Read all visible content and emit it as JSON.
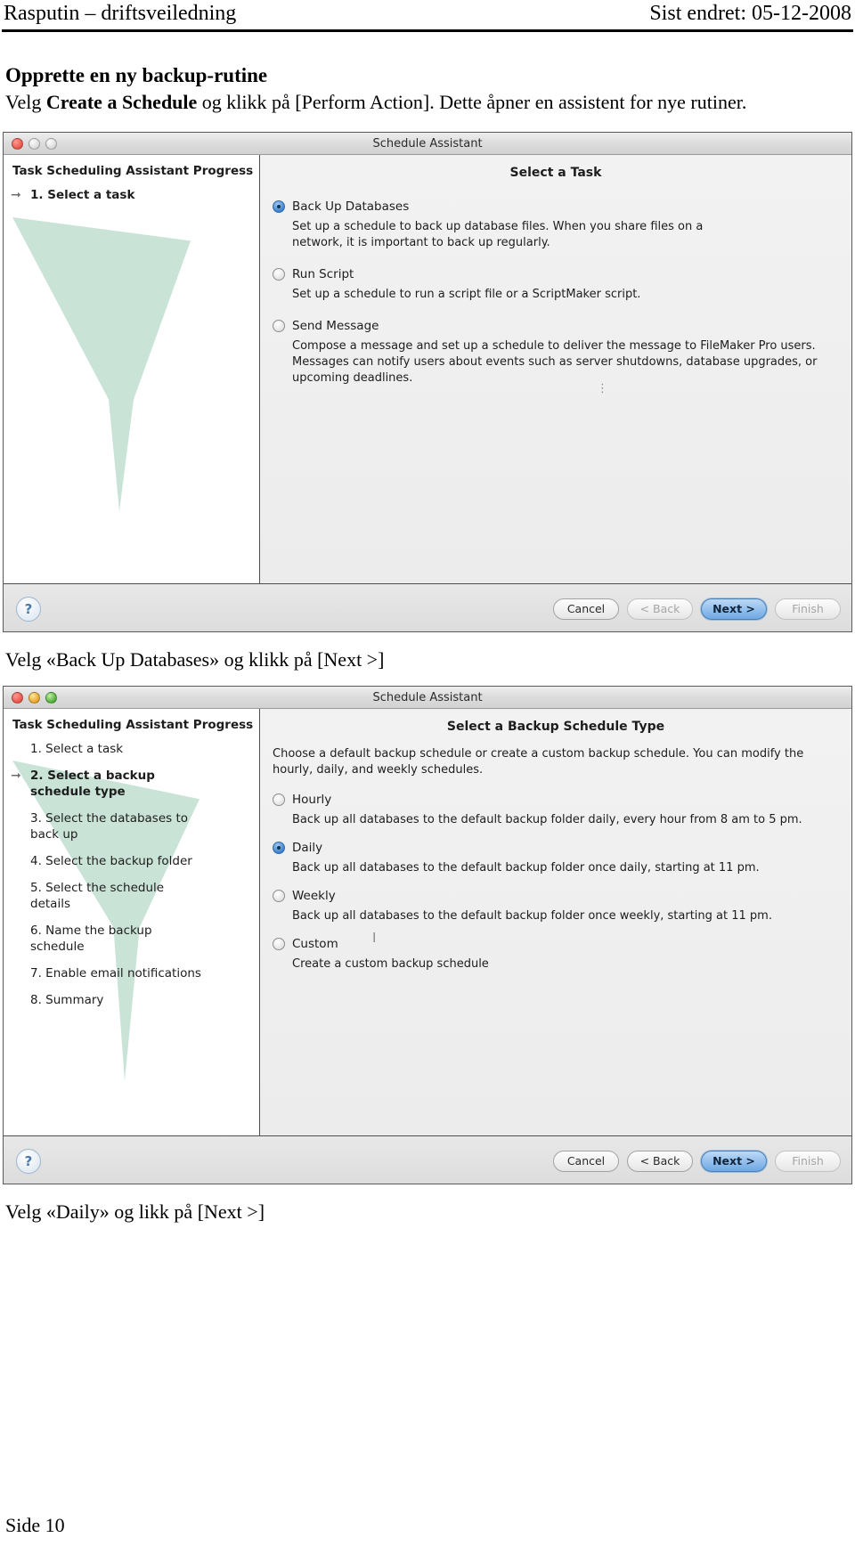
{
  "page": {
    "header_left": "Rasputin – driftsveiledning",
    "header_right": "Sist endret: 05-12-2008",
    "footer": "Side 10",
    "heading": "Opprette en ny backup-rutine",
    "intro_before": "Velg ",
    "intro_bold": "Create a Schedule",
    "intro_after": " og klikk på [Perform Action]. Dette åpner en assistent for nye rutiner.",
    "caption_1": "Velg «Back Up Databases» og klikk på [Next >]",
    "caption_2": "Velg «Daily» og likk på [Next >]"
  },
  "window1": {
    "title": "Schedule Assistant",
    "traffic": {
      "close": "close-button",
      "minimize": "minimize-button",
      "zoom": "zoom-button"
    },
    "sidebar": {
      "heading": "Task Scheduling Assistant Progress",
      "steps": [
        {
          "label": "1. Select a task",
          "current": true
        }
      ]
    },
    "content": {
      "title": "Select a Task",
      "options": [
        {
          "label": "Back Up Databases",
          "selected": true,
          "desc": "Set up a schedule to back up database files. When you share files on a network, it is important to back up regularly."
        },
        {
          "label": "Run Script",
          "selected": false,
          "desc": "Set up a schedule to run a script file or a ScriptMaker script."
        },
        {
          "label": "Send Message",
          "selected": false,
          "desc": "Compose a message and set up a schedule to deliver the message to FileMaker Pro users. Messages can notify users about events such as server shutdowns, database upgrades, or upcoming deadlines."
        }
      ]
    },
    "footer": {
      "help": "?",
      "cancel": "Cancel",
      "back": "< Back",
      "next": "Next >",
      "finish": "Finish"
    }
  },
  "window2": {
    "title": "Schedule Assistant",
    "sidebar": {
      "heading": "Task Scheduling Assistant Progress",
      "steps": [
        {
          "label": "1. Select a task",
          "current": false
        },
        {
          "label": "2. Select a backup schedule type",
          "current": true
        },
        {
          "label": "3. Select the databases to back up",
          "current": false
        },
        {
          "label": "4. Select the backup folder",
          "current": false
        },
        {
          "label": "5. Select the schedule details",
          "current": false
        },
        {
          "label": "6. Name the backup schedule",
          "current": false
        },
        {
          "label": "7. Enable email notifications",
          "current": false
        },
        {
          "label": "8. Summary",
          "current": false
        }
      ]
    },
    "content": {
      "title": "Select a Backup Schedule Type",
      "intro": "Choose a default backup schedule or create a custom backup schedule. You can modify the hourly, daily, and weekly schedules.",
      "options": [
        {
          "label": "Hourly",
          "selected": false,
          "desc": "Back up all databases to the default backup folder daily, every hour from 8 am to 5 pm."
        },
        {
          "label": "Daily",
          "selected": true,
          "desc": "Back up all databases to the default backup folder once daily, starting at 11 pm."
        },
        {
          "label": "Weekly",
          "selected": false,
          "desc": "Back up all databases to the default backup folder once weekly, starting at 11 pm."
        },
        {
          "label": "Custom",
          "selected": false,
          "desc": "Create a custom backup schedule"
        }
      ]
    },
    "footer": {
      "help": "?",
      "cancel": "Cancel",
      "back": "< Back",
      "next": "Next >",
      "finish": "Finish"
    }
  }
}
